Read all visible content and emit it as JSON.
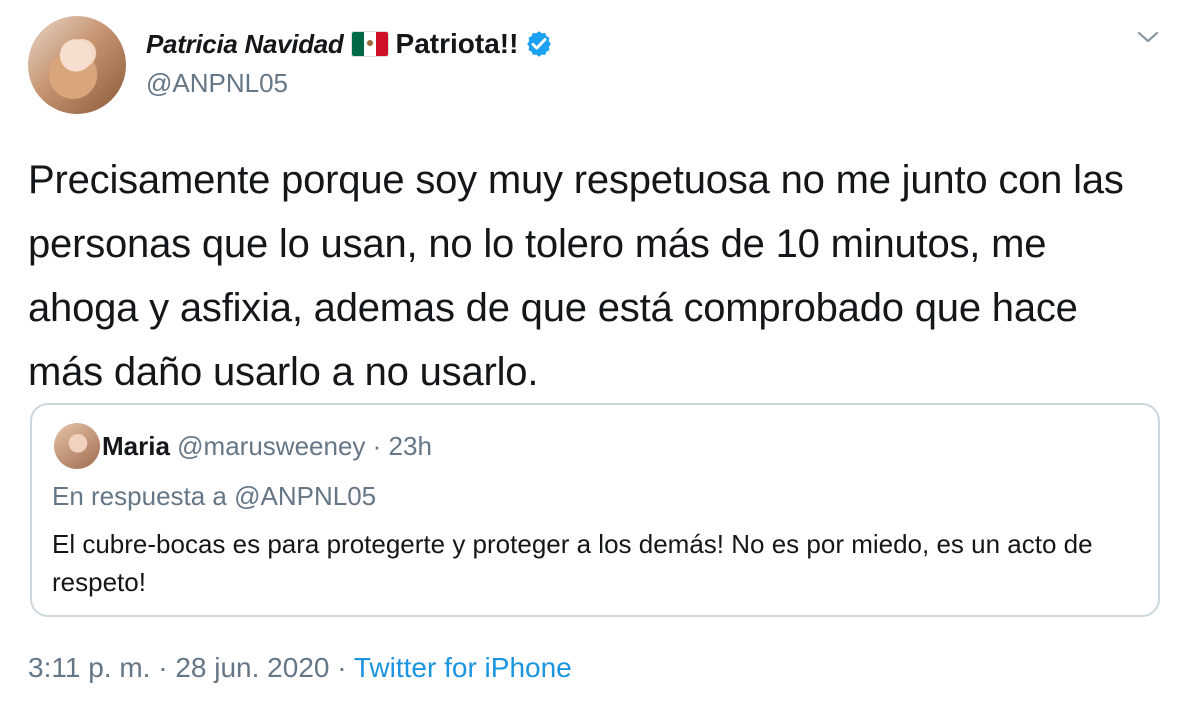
{
  "author": {
    "display_name": "Patricia Navidad",
    "suffix": "Patriota!!",
    "handle": "@ANPNL05",
    "flag_icon": "mexico-flag-emoji",
    "verified_icon": "verified-badge-icon",
    "verified_color": "#1da1f2"
  },
  "tweet": {
    "text": "Precisamente porque soy muy respetuosa no me junto con las personas que lo usan, no lo tolero más de 10 minutos, me ahoga y asfixia, ademas de que está comprobado que hace más daño usarlo a no usarlo."
  },
  "quoted": {
    "name": "Maria",
    "handle": "@marusweeney",
    "separator": "·",
    "time": "23h",
    "reply_label": "En respuesta a @ANPNL05",
    "text": "El cubre-bocas es para protegerte y proteger a los demás! No es por miedo, es un acto de respeto!"
  },
  "footer": {
    "time": "3:11 p. m.",
    "separator": "·",
    "date": "28 jun. 2020",
    "separator2": "·",
    "source": "Twitter for iPhone",
    "source_color": "#1b95e0"
  },
  "menu_icon": "chevron-down-icon",
  "colors": {
    "text": "#14171a",
    "secondary_text": "#657786",
    "border": "#ccd6dd",
    "link": "#1b95e0"
  }
}
